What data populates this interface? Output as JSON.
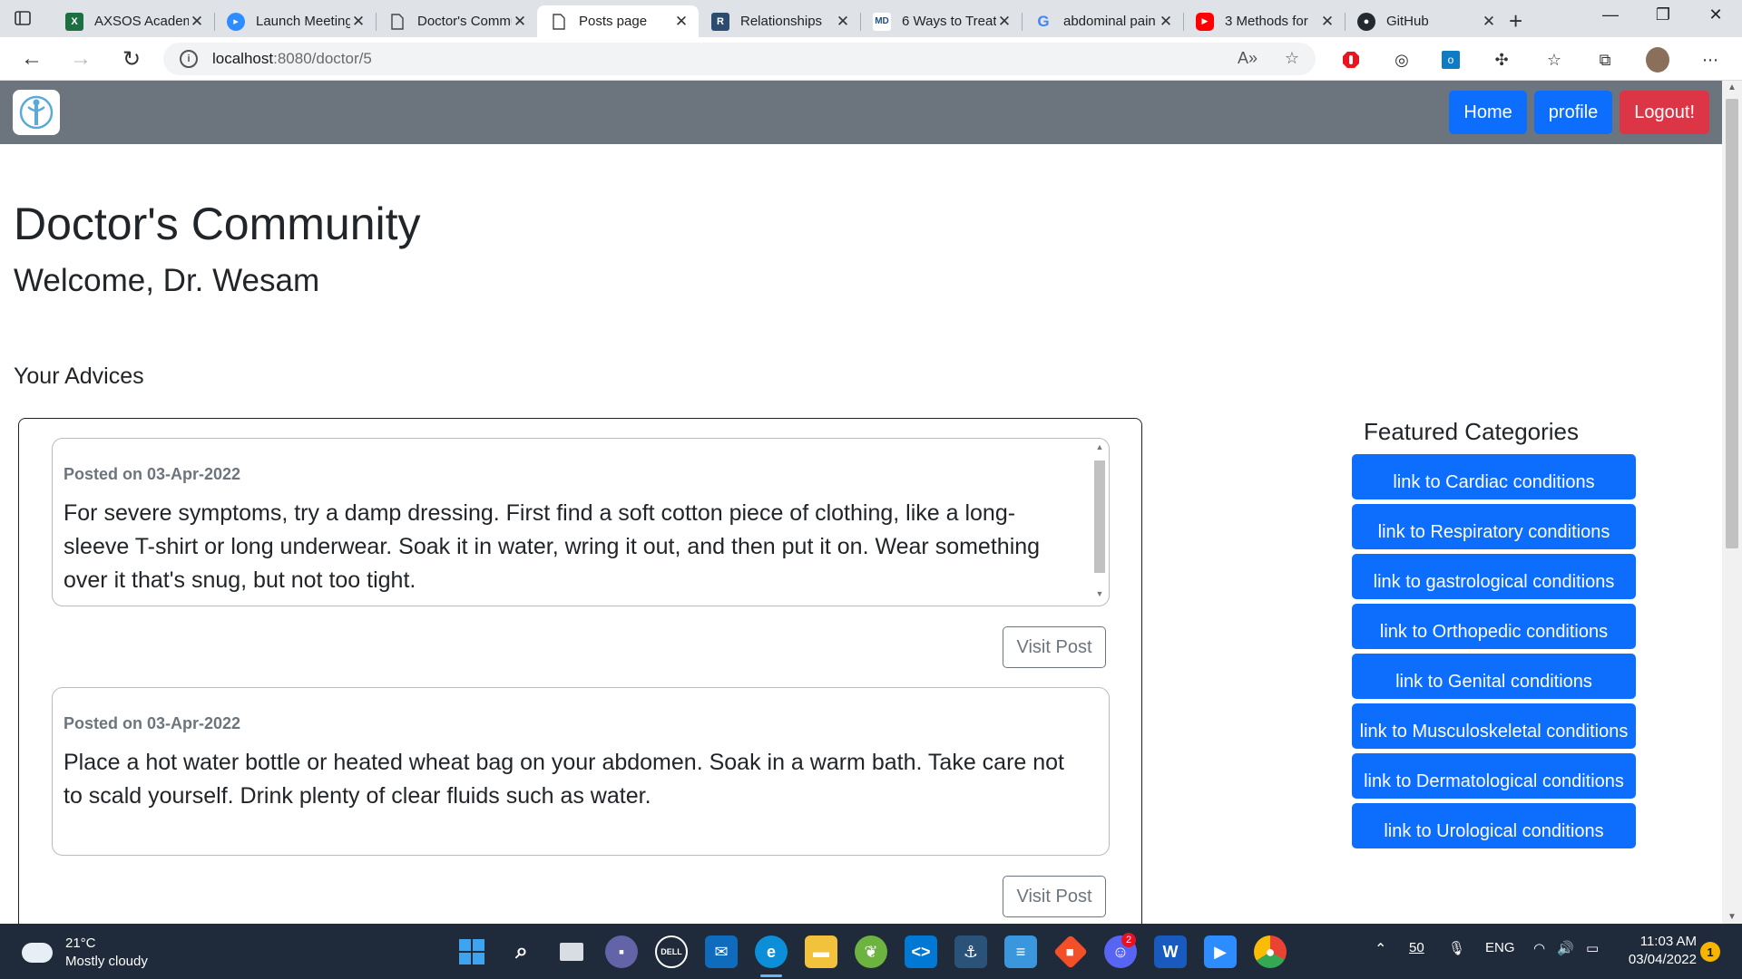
{
  "browser": {
    "tabs": [
      {
        "title": "AXSOS Academy",
        "icon": "excel-icon",
        "color": "#1d6f42"
      },
      {
        "title": "Launch Meeting",
        "icon": "zoom-icon",
        "color": "#2d8cff"
      },
      {
        "title": "Doctor's Community",
        "icon": "page-icon",
        "color": "#666666"
      },
      {
        "title": "Posts page",
        "icon": "page-icon",
        "color": "#666666"
      },
      {
        "title": "Relationships",
        "icon": "relationships-icon",
        "color": "#2b4b6f"
      },
      {
        "title": "6 Ways to Treat",
        "icon": "webmd-icon",
        "color": "#1a4f8b"
      },
      {
        "title": "abdominal pain",
        "icon": "google-icon",
        "color": "#4285f4"
      },
      {
        "title": "3 Methods for",
        "icon": "youtube-icon",
        "color": "#ff0000"
      },
      {
        "title": "GitHub",
        "icon": "github-icon",
        "color": "#24292f"
      }
    ],
    "url_host": "localhost",
    "url_path": ":8080/doctor/5"
  },
  "nav": {
    "home_label": "Home",
    "profile_label": "profile",
    "logout_label": "Logout!"
  },
  "page": {
    "title": "Doctor's Community",
    "welcome": "Welcome, Dr. Wesam",
    "section_title": "Your Advices"
  },
  "posts": [
    {
      "date": "Posted on 03-Apr-2022",
      "body": "For severe symptoms, try a damp dressing. First find a soft cotton piece of clothing, like a long-sleeve T-shirt or long underwear. Soak it in water, wring it out, and then put it on. Wear something over it that's snug, but not too tight.",
      "button": "Visit Post"
    },
    {
      "date": "Posted on 03-Apr-2022",
      "body": "Place a hot water bottle or heated wheat bag on your abdomen. Soak in a warm bath. Take care not to scald yourself. Drink plenty of clear fluids such as water.",
      "button": "Visit Post"
    }
  ],
  "featured": {
    "title": "Featured Categories",
    "categories": [
      "link to Cardiac conditions",
      "link to Respiratory conditions",
      "link to gastrological conditions",
      "link to Orthopedic conditions",
      "link to Genital conditions",
      "link to Musculoskeletal conditions",
      "link to Dermatological conditions",
      "link to Urological conditions"
    ]
  },
  "taskbar": {
    "temperature": "21°C",
    "weather": "Mostly cloudy",
    "tray_badge": "50",
    "language": "ENG",
    "time": "11:03 AM",
    "date": "03/04/2022",
    "notifications": "1",
    "discord_badge": "2"
  },
  "colors": {
    "primary": "#0d6efd",
    "danger": "#dc3545",
    "navbar": "#6c757d"
  }
}
